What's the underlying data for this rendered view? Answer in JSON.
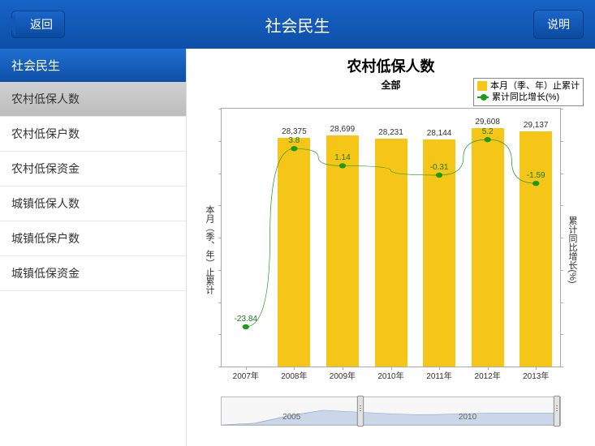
{
  "header": {
    "back_label": "返回",
    "title": "社会民生",
    "info_label": "说明"
  },
  "sidebar": {
    "header": "社会民生",
    "items": [
      {
        "label": "农村低保人数",
        "selected": true
      },
      {
        "label": "农村低保户数",
        "selected": false
      },
      {
        "label": "农村低保资金",
        "selected": false
      },
      {
        "label": "城镇低保人数",
        "selected": false
      },
      {
        "label": "城镇低保户数",
        "selected": false
      },
      {
        "label": "城镇低保资金",
        "selected": false
      }
    ]
  },
  "chart": {
    "title": "农村低保人数",
    "subtitle": "全部",
    "y_left_label": "本月（季、年）止累计",
    "y_right_label": "累计同比增长(%)",
    "legend": {
      "bar": "本月（季、年）止累计",
      "line": "累计同比增长(%)"
    },
    "colors": {
      "bar": "#f5c518",
      "line": "#1a9c1a"
    },
    "scroller_years": [
      "2005",
      "2010"
    ]
  },
  "chart_data": {
    "type": "bar+line",
    "categories": [
      "2007年",
      "2008年",
      "2009年",
      "2010年",
      "2011年",
      "2012年",
      "2013年"
    ],
    "series": [
      {
        "name": "本月（季、年）止累计",
        "type": "bar",
        "values": [
          null,
          28375,
          28699,
          28231,
          28144,
          29608,
          29137
        ]
      },
      {
        "name": "累计同比增长(%)",
        "type": "line",
        "values": [
          -23.84,
          3.8,
          1.14,
          null,
          -0.31,
          5.2,
          -1.59
        ]
      }
    ],
    "ylim_left": [
      0,
      32000
    ],
    "ylim_right": [
      -30,
      10
    ],
    "xlabel": "",
    "ylabel_left": "本月（季、年）止累计",
    "ylabel_right": "累计同比增长(%)"
  }
}
